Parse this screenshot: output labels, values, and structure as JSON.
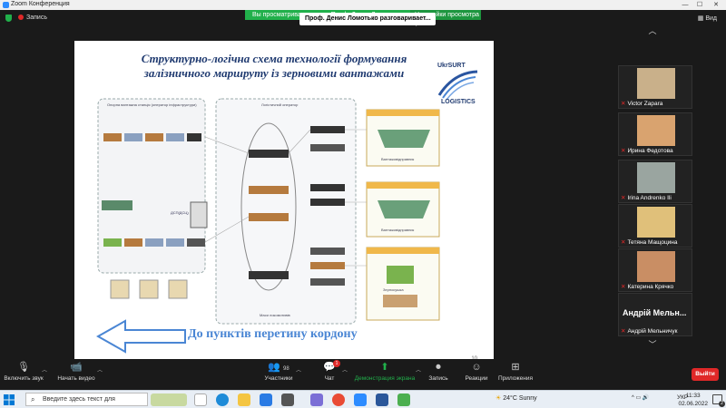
{
  "window": {
    "title": "Zoom Конференция",
    "minimize_glyph": "—",
    "maximize_glyph": "☐",
    "close_glyph": "✕"
  },
  "topbar": {
    "recording_label": "Запись",
    "share_banner_text": "Вы просматриваете экран Проф. Денис Ломотько",
    "view_options_label": "Настройки просмотра ▾",
    "speaking_text": "Проф. Денис Ломотько разговаривает...",
    "view_label": "Вид"
  },
  "slide": {
    "title_line1": "Структурно-логічна схема технології формування",
    "title_line2": "залізничного маршруту із зерновими вантажами",
    "logo_top": "UkrSURT",
    "logo_bottom": "LOGISTICS",
    "arrow_caption": "До пунктів перетину кордону",
    "slide_number": "10",
    "diagram_label_left": "Опорна вантажна станція (оператор інфраструктури)",
    "diagram_label_center": "Логістичний оператор",
    "diagram_terminal_1": "Вантажовідправник",
    "diagram_terminal_2": "Вантажовідправник",
    "diagram_terminal_3": "Зерносушка",
    "diagram_bottom_label": "Маси локомотивів",
    "diagram_dispatch": "ДСП(ДСЦ)"
  },
  "participants": [
    {
      "name": "Victor Zapara",
      "color": "#c9b08a"
    },
    {
      "name": "Ирина Федотова",
      "color": "#d9a36f"
    },
    {
      "name": "Irina Andrenko Ili",
      "color": "#9aa5a0"
    },
    {
      "name": "Тетяна Мащоцина",
      "color": "#e0c07a"
    },
    {
      "name": "Катерина Крячко",
      "color": "#c98e64"
    },
    {
      "name": "Андрій Мельничук",
      "bigname": "Андрій Мельн..."
    }
  ],
  "toolbar": {
    "audio_label": "Включить звук",
    "video_label": "Начать видео",
    "participants_label": "Участники",
    "participants_count": "98",
    "chat_label": "Чат",
    "chat_badge": "1",
    "share_label": "Демонстрация экрана",
    "record_label": "Запись",
    "reactions_label": "Реакции",
    "apps_label": "Приложения",
    "leave_label": "Выйти"
  },
  "taskbar": {
    "search_placeholder": "Введите здесь текст для",
    "weather": "24°C  Sunny",
    "language": "УКР",
    "time": "11:33",
    "date": "02.06.2022",
    "notification_count": "2"
  },
  "colors": {
    "share_green": "#21b04b",
    "leave_red": "#e02828",
    "slide_title_blue": "#1f3a70",
    "caption_blue": "#4a86d4"
  }
}
